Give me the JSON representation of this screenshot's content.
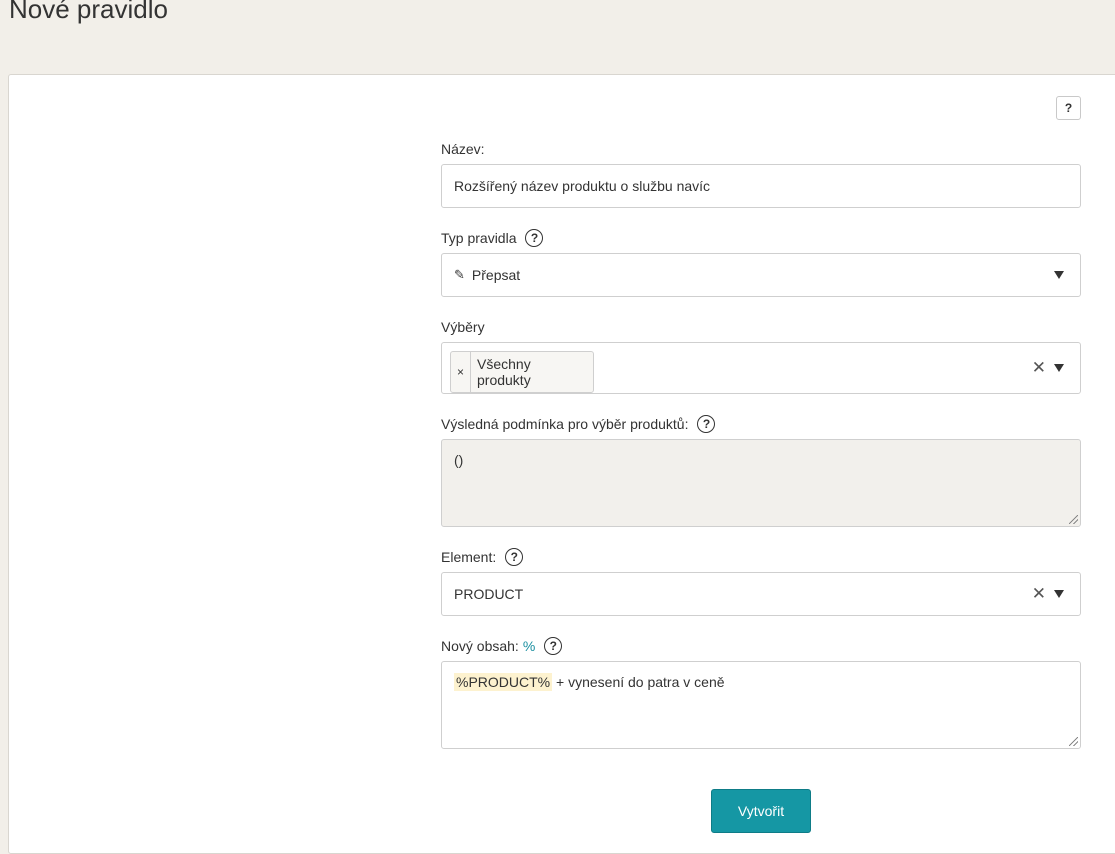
{
  "page": {
    "title": "Nové pravidlo"
  },
  "help_button": {
    "label": "?"
  },
  "form": {
    "name": {
      "label": "Název:",
      "value": "Rozšířený název produktu o službu navíc"
    },
    "rule_type": {
      "label": "Typ pravidla",
      "selected": "Přepsat",
      "icon": "pencil-icon"
    },
    "selections": {
      "label": "Výběry",
      "tags": [
        {
          "label": "Všechny produkty"
        }
      ]
    },
    "condition": {
      "label": "Výsledná podmínka pro výběr produktů:",
      "value": "()"
    },
    "element": {
      "label": "Element:",
      "selected": "PRODUCT"
    },
    "new_content": {
      "label": "Nový obsah:",
      "percent": "%",
      "token": "%PRODUCT%",
      "rest": " + vynesení do patra v ceně"
    },
    "submit_label": "Vytvořit"
  },
  "colors": {
    "accent": "#1597a4",
    "page_bg": "#f2efe9",
    "token_bg": "#fdf2cf"
  }
}
